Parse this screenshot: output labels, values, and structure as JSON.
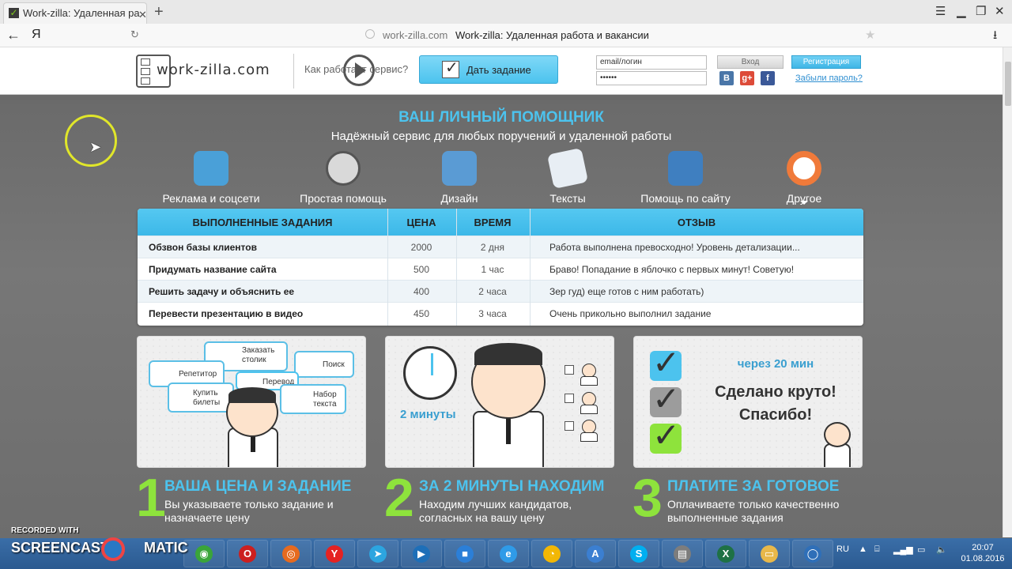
{
  "browser": {
    "tab_title": "Work-zilla: Удаленная ра",
    "url_host": "work-zilla.com",
    "page_title": "Work-zilla: Удаленная работа и вакансии",
    "yandex_glyph": "Я"
  },
  "header": {
    "logo_text": "work-zilla.com",
    "how_works": "Как работает сервис?",
    "give_task": "Дать задание",
    "email_value": "email/логин",
    "password_value": "••••••",
    "login_button": "Вход",
    "register_button": "Регистрация",
    "forgot_password": "Забыли пароль?",
    "socials": [
      {
        "name": "vk",
        "glyph": "B",
        "color": "#4a76a8"
      },
      {
        "name": "google-plus",
        "glyph": "g+",
        "color": "#dd4b39"
      },
      {
        "name": "facebook",
        "glyph": "f",
        "color": "#3b5998"
      }
    ]
  },
  "hero": {
    "title": "ВАШ ЛИЧНЫЙ ПОМОЩНИК",
    "subtitle": "Надёжный сервис для любых поручений и удаленной работы",
    "categories": [
      {
        "label": "Реклама и соцсети",
        "icon": "social-globe-icon",
        "color": "#4aa0d8"
      },
      {
        "label": "Простая помощь",
        "icon": "stopwatch-icon",
        "color": "#d9d9d9"
      },
      {
        "label": "Дизайн",
        "icon": "design-icon",
        "color": "#5a9bd4"
      },
      {
        "label": "Тексты",
        "icon": "document-icon",
        "color": "#e8eef4"
      },
      {
        "label": "Помощь по сайту",
        "icon": "website-gear-icon",
        "color": "#3f7fc0"
      },
      {
        "label": "Другое",
        "icon": "lifebuoy-icon",
        "color": "#f07a3a"
      }
    ]
  },
  "tasks": {
    "headers": [
      "ВЫПОЛНЕННЫЕ ЗАДАНИЯ",
      "ЦЕНА",
      "ВРЕМЯ",
      "ОТЗЫВ"
    ],
    "rows": [
      {
        "task": "Обзвон базы клиентов",
        "price": "2000",
        "time": "2 дня",
        "review": "Работа выполнена превосходно! Уровень детализации..."
      },
      {
        "task": "Придумать название сайта",
        "price": "500",
        "time": "1 час",
        "review": "Браво! Попадание в яблочко с первых минут! Советую!"
      },
      {
        "task": "Решить задачу и объяснить ее",
        "price": "400",
        "time": "2 часа",
        "review": "Зер гуд) еще готов с ним работать)"
      },
      {
        "task": "Перевести презентацию в видео",
        "price": "450",
        "time": "3 часа",
        "review": "Очень прикольно выполнил задание"
      }
    ]
  },
  "panels": {
    "bubbles": [
      "Заказать столик",
      "Репетитор",
      "Поиск",
      "Перевод",
      "Купить билеты",
      "Набор текста"
    ],
    "two_minutes": "2 минуты",
    "in_20_min": "через 20 мин",
    "done_line1": "Сделано круто!",
    "done_line2": "Спасибо!"
  },
  "steps": [
    {
      "num": "1",
      "title": "ВАША ЦЕНА И ЗАДАНИЕ",
      "text": "Вы указываете только задание и назначаете цену"
    },
    {
      "num": "2",
      "title": "ЗА 2 МИНУТЫ НАХОДИМ",
      "text": "Находим лучших кандидатов, согласных на вашу цену"
    },
    {
      "num": "3",
      "title": "ПЛАТИТЕ ЗА ГОТОВОЕ",
      "text": "Оплачиваете только качественно выполненные задания"
    }
  ],
  "watermark": {
    "recorded_with": "RECORDED WITH",
    "screencast": "SCREENCAST",
    "matic": "MATIC"
  },
  "taskbar": {
    "apps": [
      {
        "name": "chrome",
        "glyph": "◉",
        "color": "#3aa53a"
      },
      {
        "name": "opera",
        "glyph": "O",
        "color": "#cc1f1f"
      },
      {
        "name": "firefox",
        "glyph": "◎",
        "color": "#e66a1f"
      },
      {
        "name": "yandex-browser",
        "glyph": "Y",
        "color": "#e52222"
      },
      {
        "name": "telegram",
        "glyph": "➤",
        "color": "#2ca5e0"
      },
      {
        "name": "media-player",
        "glyph": "▶",
        "color": "#1e6fb8"
      },
      {
        "name": "store",
        "glyph": "■",
        "color": "#2b7fd8"
      },
      {
        "name": "internet-explorer",
        "glyph": "e",
        "color": "#2f9be8"
      },
      {
        "name": "chart-app",
        "glyph": "◔",
        "color": "#f2b705"
      },
      {
        "name": "font-app",
        "glyph": "A",
        "color": "#3b7fd1"
      },
      {
        "name": "skype",
        "glyph": "S",
        "color": "#00aff0"
      },
      {
        "name": "presentation",
        "glyph": "▤",
        "color": "#7d7d7d"
      },
      {
        "name": "excel",
        "glyph": "X",
        "color": "#1e7145"
      },
      {
        "name": "file-explorer",
        "glyph": "▭",
        "color": "#e8b84a"
      },
      {
        "name": "recorder",
        "glyph": "◯",
        "color": "#2f6fb8"
      }
    ],
    "language": "RU",
    "time": "20:07",
    "date": "01.08.2016"
  }
}
